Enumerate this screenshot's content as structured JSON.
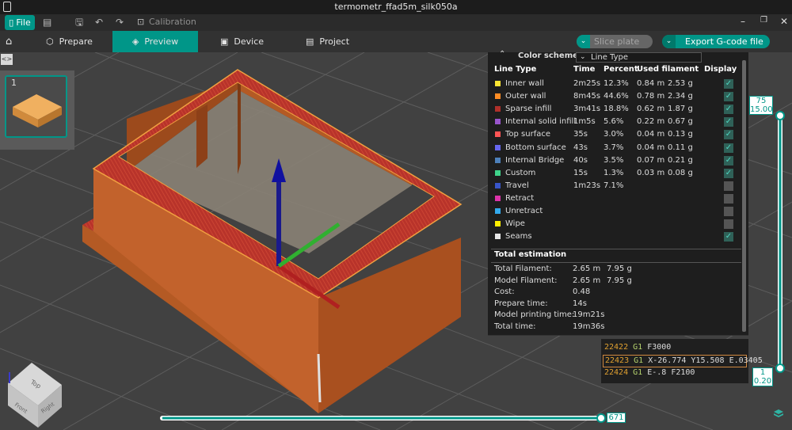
{
  "window": {
    "title": "termometr_ffad5m_silk050a"
  },
  "menubar": {
    "file_label": "File",
    "calibration_label": "Calibration"
  },
  "tabs": [
    {
      "label": "Prepare",
      "icon": "cube-icon"
    },
    {
      "label": "Preview",
      "icon": "layers-icon",
      "active": true
    },
    {
      "label": "Device",
      "icon": "device-icon"
    },
    {
      "label": "Project",
      "icon": "project-icon"
    }
  ],
  "actions": {
    "slice_label": "Slice plate",
    "export_label": "Export G-code file"
  },
  "plate": {
    "number": "1"
  },
  "legend": {
    "color_scheme_label": "Color scheme",
    "color_scheme_value": "Line Type",
    "headers": {
      "line_type": "Line Type",
      "time": "Time",
      "percent": "Percent",
      "used_filament": "Used filament",
      "display": "Display"
    },
    "rows": [
      {
        "name": "Inner wall",
        "color": "#ffe633",
        "time": "2m25s",
        "percent": "12.3%",
        "len": "0.84 m",
        "weight": "2.53 g",
        "display": true
      },
      {
        "name": "Outer wall",
        "color": "#ff8c24",
        "time": "8m45s",
        "percent": "44.6%",
        "len": "0.78 m",
        "weight": "2.34 g",
        "display": true
      },
      {
        "name": "Sparse infill",
        "color": "#b0302a",
        "time": "3m41s",
        "percent": "18.8%",
        "len": "0.62 m",
        "weight": "1.87 g",
        "display": true
      },
      {
        "name": "Internal solid infill",
        "color": "#9955cc",
        "time": "1m5s",
        "percent": "5.6%",
        "len": "0.22 m",
        "weight": "0.67 g",
        "display": true
      },
      {
        "name": "Top surface",
        "color": "#ff5555",
        "time": "35s",
        "percent": "3.0%",
        "len": "0.04 m",
        "weight": "0.13 g",
        "display": true
      },
      {
        "name": "Bottom surface",
        "color": "#6666ee",
        "time": "43s",
        "percent": "3.7%",
        "len": "0.04 m",
        "weight": "0.11 g",
        "display": true
      },
      {
        "name": "Internal Bridge",
        "color": "#4d80ba",
        "time": "40s",
        "percent": "3.5%",
        "len": "0.07 m",
        "weight": "0.21 g",
        "display": true
      },
      {
        "name": "Custom",
        "color": "#3fd38a",
        "time": "15s",
        "percent": "1.3%",
        "len": "0.03 m",
        "weight": "0.08 g",
        "display": true
      },
      {
        "name": "Travel",
        "color": "#3855c8",
        "time": "1m23s",
        "percent": "7.1%",
        "len": "",
        "weight": "",
        "display": false
      },
      {
        "name": "Retract",
        "color": "#dd33aa",
        "time": "",
        "percent": "",
        "len": "",
        "weight": "",
        "display": false
      },
      {
        "name": "Unretract",
        "color": "#33aaee",
        "time": "",
        "percent": "",
        "len": "",
        "weight": "",
        "display": false
      },
      {
        "name": "Wipe",
        "color": "#ffee00",
        "time": "",
        "percent": "",
        "len": "",
        "weight": "",
        "display": false
      },
      {
        "name": "Seams",
        "color": "#e6e6e6",
        "time": "",
        "percent": "",
        "len": "",
        "weight": "",
        "display": true
      }
    ],
    "total_title": "Total estimation",
    "totals": [
      {
        "label": "Total Filament:",
        "value": "2.65 m",
        "value2": "7.95 g"
      },
      {
        "label": "Model Filament:",
        "value": "2.65 m",
        "value2": "7.95 g"
      },
      {
        "label": "Cost:",
        "value": "0.48",
        "value2": ""
      },
      {
        "label": "Prepare time:",
        "value": "14s",
        "value2": ""
      },
      {
        "label": "Model printing time:",
        "value": "19m21s",
        "value2": ""
      },
      {
        "label": "Total time:",
        "value": "19m36s",
        "value2": ""
      }
    ]
  },
  "gcode": [
    {
      "num": "22422",
      "cmd": "G1",
      "args": "F3000",
      "selected": false
    },
    {
      "num": "22423",
      "cmd": "G1",
      "args": "X-26.774 Y15.508 E.03405",
      "selected": true
    },
    {
      "num": "22424",
      "cmd": "G1",
      "args": "E-.8 F2100",
      "selected": false
    }
  ],
  "layer_slider": {
    "top_layer": "75",
    "top_height": "15.00",
    "bottom_layer": "1",
    "bottom_height": "0.20"
  },
  "move_slider": {
    "value": "671"
  },
  "viewcube": {
    "top": "Top",
    "front": "Front",
    "right": "Right"
  },
  "colors": {
    "accent": "#009688",
    "bed": "#414141",
    "model": "#c0602a",
    "wall": "#c02f27"
  }
}
